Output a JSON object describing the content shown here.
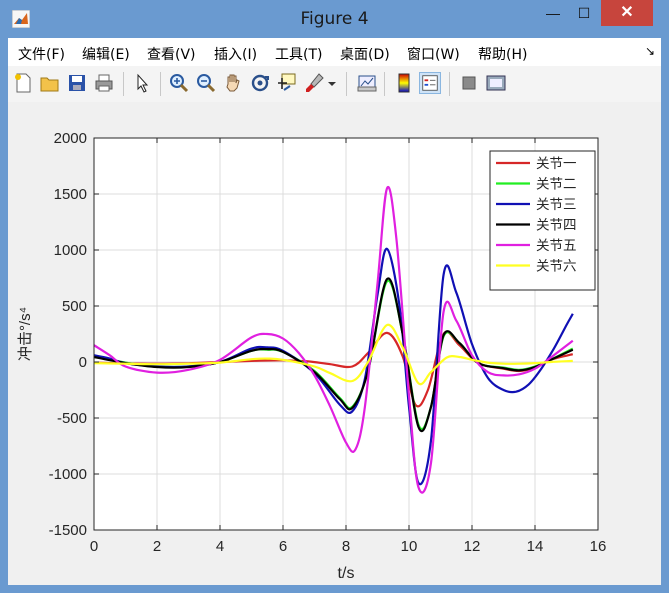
{
  "window": {
    "title": "Figure 4",
    "min_glyph": "—",
    "max_glyph": "☐",
    "close_glyph": "✕"
  },
  "menu": {
    "items": [
      "文件(F)",
      "编辑(E)",
      "查看(V)",
      "插入(I)",
      "工具(T)",
      "桌面(D)",
      "窗口(W)",
      "帮助(H)"
    ],
    "arrow": "↘"
  },
  "toolbar": {
    "icons": [
      "new-figure-icon",
      "open-file-icon",
      "save-icon",
      "print-icon",
      "pointer-icon",
      "zoom-in-icon",
      "zoom-out-icon",
      "pan-hand-icon",
      "rotate-3d-icon",
      "data-cursor-icon",
      "brush-icon",
      "link-plot-icon",
      "colorbar-icon",
      "legend-icon",
      "hide-plot-tools-icon",
      "show-plot-tools-icon"
    ]
  },
  "colors": {
    "axes_bg": "#ffffff",
    "grid": "#dcdcdc",
    "figure_bg": "#f0f0f0"
  },
  "chart_data": {
    "type": "line",
    "title": "",
    "xlabel": "t/s",
    "ylabel": "冲击°/s⁴",
    "xlim": [
      0,
      16
    ],
    "ylim": [
      -1500,
      2000
    ],
    "xticks": [
      0,
      2,
      4,
      6,
      8,
      10,
      12,
      14,
      16
    ],
    "yticks": [
      -1500,
      -1000,
      -500,
      0,
      500,
      1000,
      1500,
      2000
    ],
    "grid": true,
    "legend_position": "top-right",
    "series": [
      {
        "name": "关节一",
        "color": "#d62728",
        "x": [
          0,
          1,
          2,
          3,
          4,
          5,
          6,
          6.8,
          7.5,
          8.2,
          8.7,
          9.3,
          9.8,
          10.2,
          10.6,
          11.1,
          11.6,
          12.2,
          13,
          13.5,
          14,
          14.5,
          15.2
        ],
        "y": [
          -5,
          -12,
          -15,
          -12,
          0,
          10,
          15,
          5,
          -20,
          -40,
          80,
          260,
          50,
          -380,
          -250,
          250,
          150,
          -10,
          -60,
          -80,
          -50,
          20,
          70
        ]
      },
      {
        "name": "关节二",
        "color": "#22ee22",
        "x": [
          0,
          1,
          2,
          3,
          4,
          5,
          5.5,
          6,
          7,
          7.8,
          8.2,
          8.7,
          9.3,
          9.8,
          10.3,
          10.7,
          11.1,
          11.6,
          12.2,
          13,
          13.5,
          14,
          14.5,
          15.2
        ],
        "y": [
          50,
          -5,
          -40,
          -40,
          0,
          100,
          110,
          90,
          -80,
          -320,
          -400,
          -80,
          720,
          250,
          -560,
          -400,
          230,
          170,
          -10,
          -50,
          -70,
          -40,
          20,
          120
        ]
      },
      {
        "name": "关节三",
        "color": "#1010b4",
        "x": [
          0,
          0.5,
          1,
          2,
          3,
          4,
          5,
          5.5,
          6,
          7,
          7.8,
          8.2,
          8.6,
          9.0,
          9.3,
          9.7,
          10.0,
          10.3,
          10.7,
          11.1,
          11.5,
          12,
          12.5,
          13,
          13.4,
          13.8,
          14.2,
          14.6,
          15,
          15.2
        ],
        "y": [
          60,
          30,
          -10,
          -40,
          -40,
          0,
          120,
          130,
          100,
          -100,
          -380,
          -440,
          -150,
          600,
          1010,
          500,
          -400,
          -1080,
          -700,
          780,
          620,
          160,
          -140,
          -250,
          -265,
          -200,
          -60,
          120,
          330,
          430
        ]
      },
      {
        "name": "关节四",
        "color": "#000000",
        "x": [
          0,
          1,
          2,
          3,
          4,
          5,
          5.5,
          6,
          7,
          7.8,
          8.2,
          8.7,
          9.3,
          9.8,
          10.3,
          10.7,
          11.1,
          11.6,
          12.2,
          13,
          13.5,
          14,
          14.5,
          15.2
        ],
        "y": [
          45,
          -10,
          -45,
          -45,
          0,
          100,
          115,
          90,
          -90,
          -330,
          -410,
          -80,
          740,
          250,
          -580,
          -400,
          240,
          170,
          -10,
          -55,
          -75,
          -45,
          20,
          110
        ]
      },
      {
        "name": "关节五",
        "color": "#e020e0",
        "x": [
          0,
          0.5,
          1,
          2,
          3,
          4,
          5,
          5.5,
          6,
          6.5,
          7,
          7.5,
          8,
          8.3,
          8.6,
          9.0,
          9.3,
          9.6,
          10.0,
          10.3,
          10.7,
          11.1,
          11.5,
          12,
          12.5,
          13,
          13.5,
          14,
          14.5,
          15.2
        ],
        "y": [
          150,
          60,
          -40,
          -95,
          -70,
          20,
          220,
          250,
          210,
          80,
          -120,
          -400,
          -720,
          -780,
          -400,
          700,
          1550,
          1100,
          -300,
          -1120,
          -900,
          450,
          370,
          60,
          -90,
          -120,
          -110,
          -60,
          40,
          190
        ]
      },
      {
        "name": "关节六",
        "color": "#ffff22",
        "x": [
          0,
          1,
          2,
          3,
          4,
          5,
          5.5,
          6,
          7,
          7.5,
          8.2,
          8.7,
          9.3,
          9.8,
          10.3,
          10.7,
          11.2,
          11.6,
          12,
          12.5,
          13,
          13.5,
          14,
          14.5,
          15.2
        ],
        "y": [
          -10,
          -15,
          -20,
          -15,
          -5,
          25,
          30,
          20,
          -40,
          -100,
          -170,
          0,
          330,
          130,
          -190,
          -90,
          40,
          45,
          20,
          -5,
          -15,
          -15,
          -10,
          0,
          10
        ]
      }
    ]
  }
}
